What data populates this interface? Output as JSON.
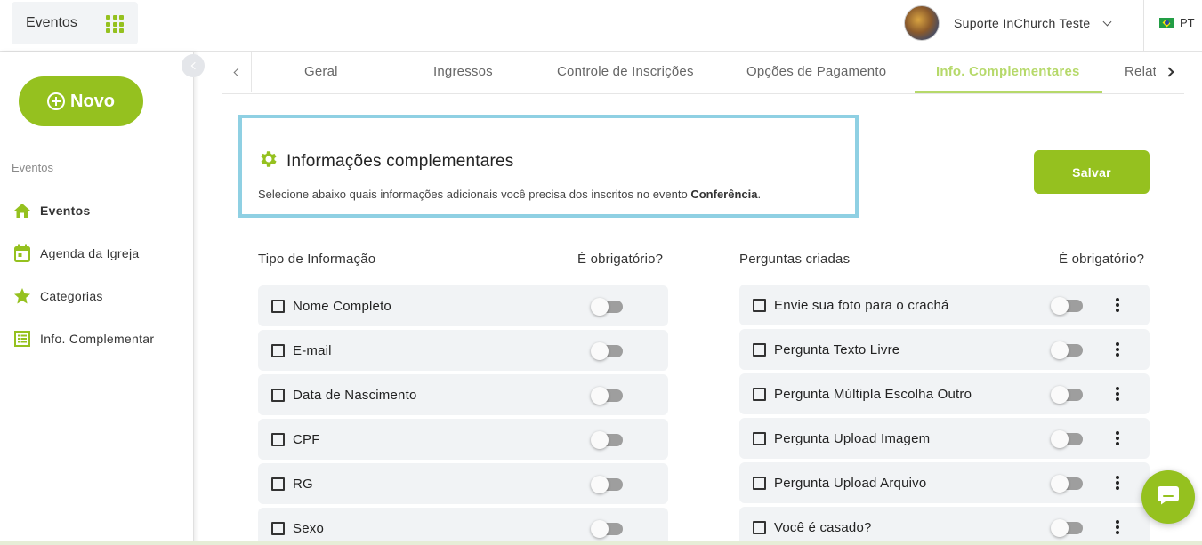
{
  "topbar": {
    "app_title": "Eventos",
    "user_name": "Suporte InChurch Teste",
    "language": "PT"
  },
  "sidebar": {
    "new_button_label": "Novo",
    "section_title": "Eventos",
    "items": [
      {
        "label": "Eventos",
        "icon": "home-icon"
      },
      {
        "label": "Agenda da Igreja",
        "icon": "calendar-icon"
      },
      {
        "label": "Categorias",
        "icon": "star-icon"
      },
      {
        "label": "Info. Complementar",
        "icon": "list-icon"
      }
    ]
  },
  "tabs": [
    {
      "label": "Geral"
    },
    {
      "label": "Ingressos"
    },
    {
      "label": "Controle de Inscrições"
    },
    {
      "label": "Opções de Pagamento"
    },
    {
      "label": "Info. Complementares"
    },
    {
      "label": "Relat"
    }
  ],
  "active_tab": "Info. Complementares",
  "info": {
    "title": "Informações complementares",
    "description_prefix": "Selecione abaixo quais informações adicionais você precisa dos inscritos no evento ",
    "event_name": "Conferência",
    "description_suffix": "."
  },
  "save_label": "Salvar",
  "left_table": {
    "header_type": "Tipo de Informação",
    "header_required": "É obrigatório?",
    "rows": [
      {
        "label": "Nome Completo",
        "checked": false,
        "required": false
      },
      {
        "label": "E-mail",
        "checked": false,
        "required": false
      },
      {
        "label": "Data de Nascimento",
        "checked": false,
        "required": false
      },
      {
        "label": "CPF",
        "checked": false,
        "required": false
      },
      {
        "label": "RG",
        "checked": false,
        "required": false
      },
      {
        "label": "Sexo",
        "checked": false,
        "required": false
      }
    ]
  },
  "right_table": {
    "header_questions": "Perguntas criadas",
    "header_required": "É obrigatório?",
    "rows": [
      {
        "label": "Envie sua foto para o crachá",
        "checked": false,
        "required": false
      },
      {
        "label": "Pergunta Texto Livre",
        "checked": false,
        "required": false
      },
      {
        "label": "Pergunta Múltipla Escolha Outro",
        "checked": false,
        "required": false
      },
      {
        "label": "Pergunta Upload Imagem",
        "checked": false,
        "required": false
      },
      {
        "label": "Pergunta Upload Arquivo",
        "checked": false,
        "required": false
      },
      {
        "label": "Você é casado?",
        "checked": false,
        "required": false
      }
    ]
  },
  "colors": {
    "accent": "#95c11f",
    "active_tab": "#b6d96a",
    "info_border": "#8fd0e3"
  }
}
